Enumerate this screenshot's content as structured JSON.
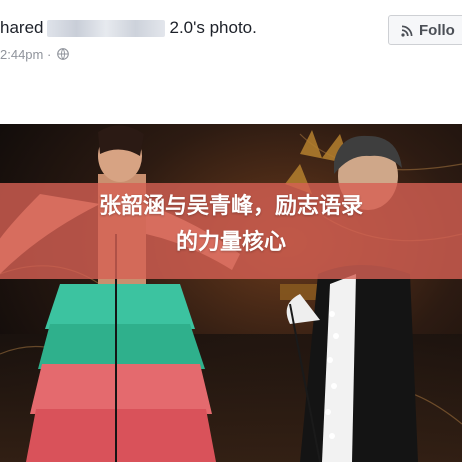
{
  "post": {
    "shared_prefix": "hared",
    "shared_suffix": "2.0's photo.",
    "time": "2:44pm",
    "separator": "·",
    "follow_label": "Follo"
  },
  "photo": {
    "caption_line1": "张韶涵与吴青峰，励志语录",
    "caption_line2": "的力量核心",
    "overlay_color": "#d66054"
  },
  "icons": [
    "globe-icon",
    "rss-icon"
  ]
}
